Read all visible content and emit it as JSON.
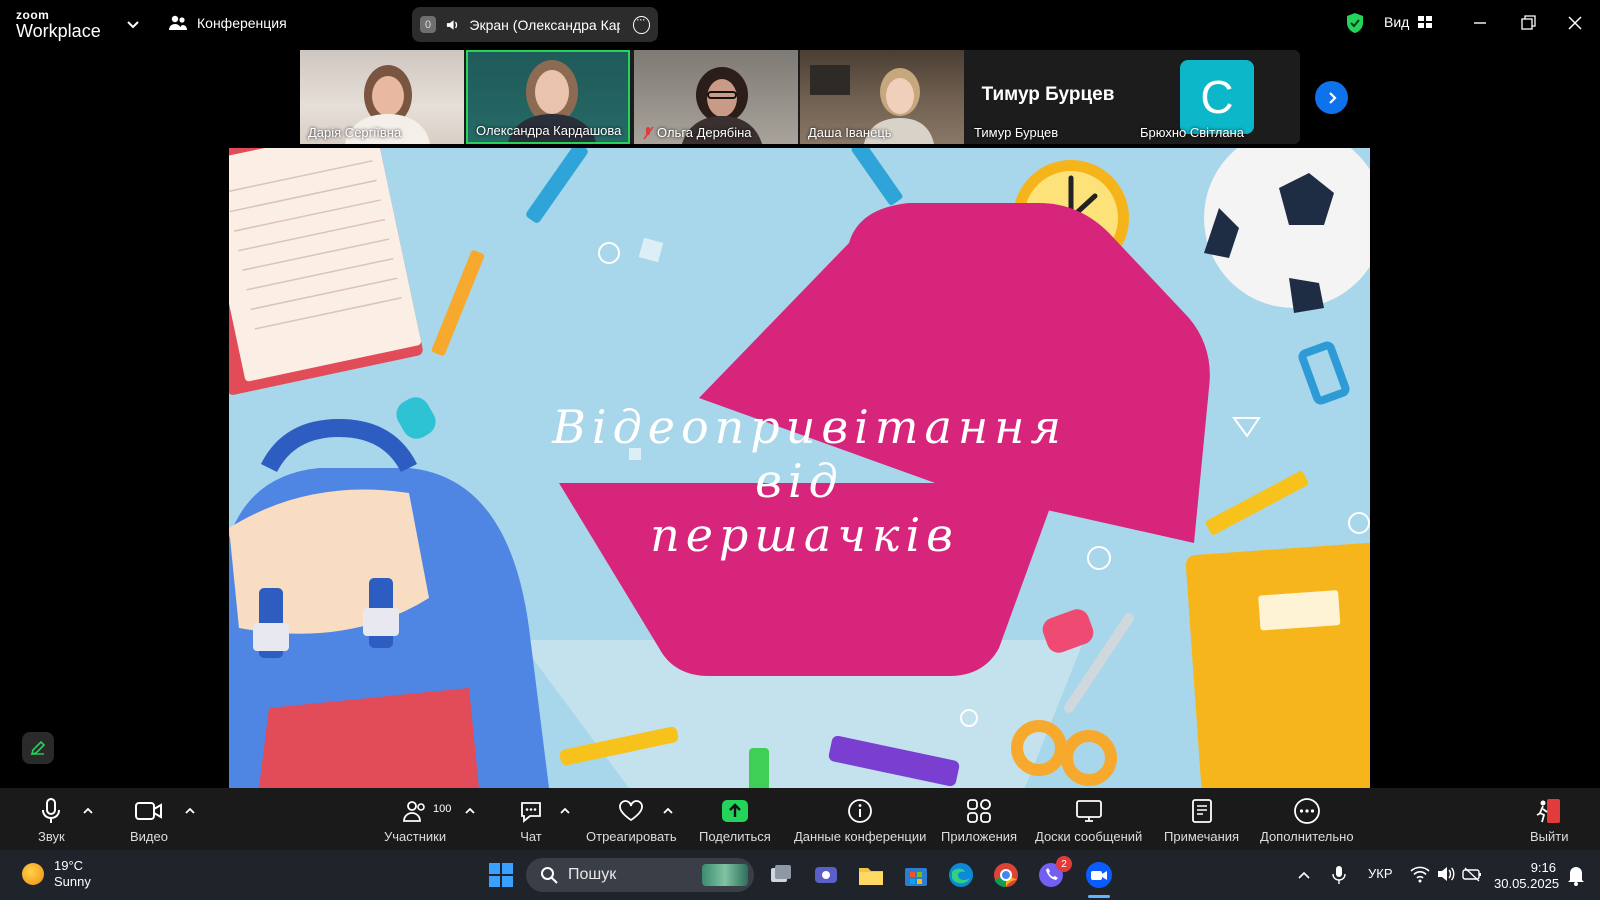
{
  "app": {
    "logo_line1": "zoom",
    "logo_line2": "Workplace",
    "meeting_label": "Конференция",
    "share": {
      "badge": "0",
      "label": "Экран (Олександра Кардашова)"
    },
    "view_label": "Вид",
    "secure_color": "#24d35a"
  },
  "participants": [
    {
      "name": "Дарія Сергіївна",
      "muted": false
    },
    {
      "name": "Олександра Кардашова",
      "muted": false,
      "active": true
    },
    {
      "name": "Ольга Дерябіна",
      "muted": true
    },
    {
      "name": "Даша Іванець",
      "muted": false
    },
    {
      "name": "Тимур Бурцев",
      "muted": false,
      "no_video": true
    },
    {
      "name": "Брюхно Світлана",
      "muted": false,
      "avatar_letter": "С"
    }
  ],
  "shared_slide": {
    "line1": "Відеопривітання",
    "line2": "від",
    "line3": "першачків"
  },
  "toolbar": {
    "audio": "Звук",
    "video": "Видео",
    "participants": "Участники",
    "participants_count": "100",
    "chat": "Чат",
    "react": "Отреагировать",
    "share": "Поделиться",
    "meeting_info": "Данные конференции",
    "apps": "Приложения",
    "whiteboards": "Доски сообщений",
    "notes": "Примечания",
    "more": "Дополнительно",
    "leave": "Выйти"
  },
  "taskbar": {
    "weather_temp": "19°C",
    "weather_desc": "Sunny",
    "search_placeholder": "Пошук",
    "viber_badge": "2",
    "lang": "УКР",
    "time": "9:16",
    "date": "30.05.2025"
  }
}
